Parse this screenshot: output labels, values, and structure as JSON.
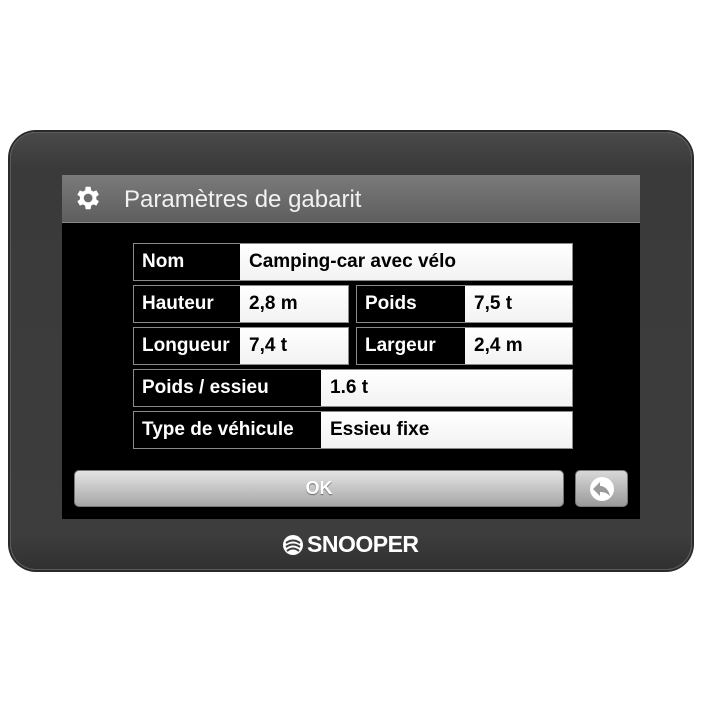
{
  "header": {
    "title": "Paramètres de gabarit",
    "icon": "gear-icon"
  },
  "fields": {
    "nom": {
      "label": "Nom",
      "value": "Camping-car avec vélo"
    },
    "hauteur": {
      "label": "Hauteur",
      "value": "2,8 m"
    },
    "poids": {
      "label": "Poids",
      "value": "7,5 t"
    },
    "longueur": {
      "label": "Longueur",
      "value": "7,4 t"
    },
    "largeur": {
      "label": "Largeur",
      "value": "2,4 m"
    },
    "poids_essieu": {
      "label": "Poids / essieu",
      "value": "1.6 t"
    },
    "type_vehicule": {
      "label": "Type de véhicule",
      "value": "Essieu fixe"
    }
  },
  "buttons": {
    "ok": "OK",
    "back_icon": "back-arrow-icon"
  },
  "brand": {
    "name": "SNOOPER"
  }
}
